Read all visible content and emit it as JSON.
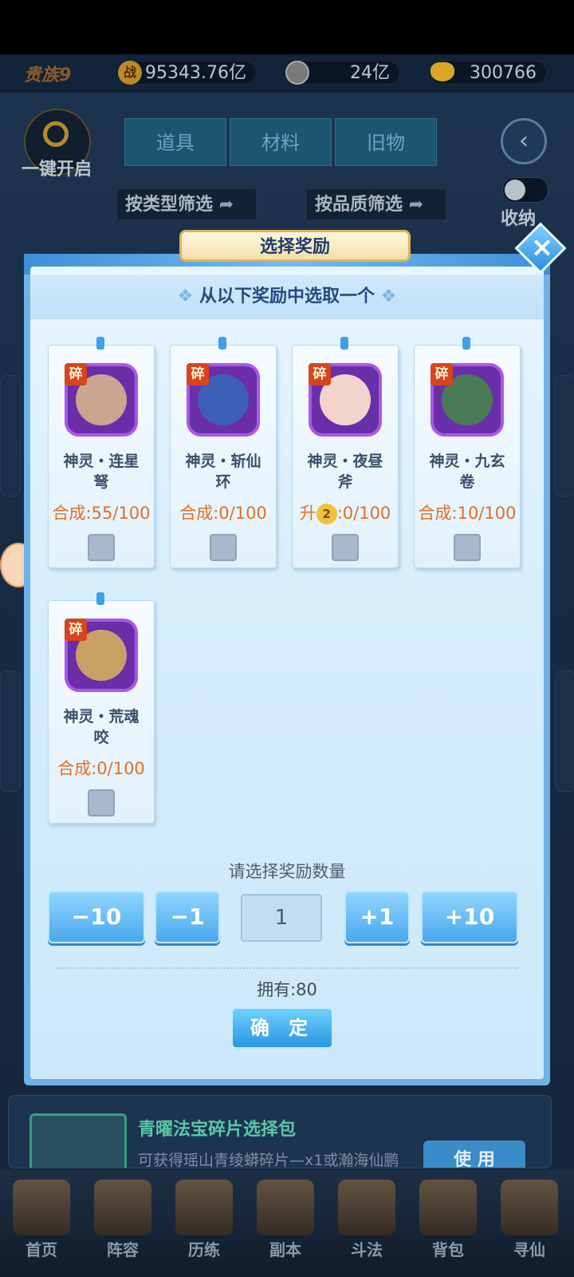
{
  "header": {
    "rank": "贵族9",
    "power_icon": "战",
    "power": "95343.76亿",
    "coin": "24亿",
    "ingot": "300766"
  },
  "left_controls": {
    "one_key_open": "一键开启"
  },
  "tabs": [
    {
      "label": "道具"
    },
    {
      "label": "材料"
    },
    {
      "label": "旧物"
    }
  ],
  "filters": {
    "by_type": "按类型筛选",
    "by_quality": "按品质筛选"
  },
  "collapse_label": "收纳",
  "dialog": {
    "title": "选择奖励",
    "subtitle": "从以下奖励中选取一个",
    "rewards": [
      {
        "badge": "碎",
        "name_line1": "神灵・连星",
        "name_line2": "弩",
        "progress": "合成:55/100",
        "face": "#caa58f"
      },
      {
        "badge": "碎",
        "name_line1": "神灵・斩仙",
        "name_line2": "环",
        "progress": "合成:0/100",
        "face": "#3d5fb8"
      },
      {
        "badge": "碎",
        "name_line1": "神灵・夜昼",
        "name_line2": "斧",
        "progress_prefix": "升",
        "star": "2",
        "progress_suffix": ":0/100",
        "face": "#f2d4cc"
      },
      {
        "badge": "碎",
        "name_line1": "神灵・九玄",
        "name_line2": "卷",
        "progress": "合成:10/100",
        "face": "#4a7a58"
      },
      {
        "badge": "碎",
        "name_line1": "神灵・荒魂",
        "name_line2": "咬",
        "progress": "合成:0/100",
        "face": "#c9a064"
      }
    ],
    "qty_prompt": "请选择奖励数量",
    "qty_buttons": {
      "minus10": "−10",
      "minus1": "−1",
      "plus1": "+1",
      "plus10": "+10"
    },
    "qty_value": "1",
    "owned": "拥有:80",
    "confirm": "确 定"
  },
  "pack": {
    "title": "青曜法宝碎片选择包",
    "desc": "可获得瑶山青绫蟒碎片—x1或瀚海仙鹏",
    "use_btn": "使 用"
  },
  "nav": [
    {
      "label": "首页"
    },
    {
      "label": "阵容"
    },
    {
      "label": "历练"
    },
    {
      "label": "副本"
    },
    {
      "label": "斗法"
    },
    {
      "label": "背包"
    },
    {
      "label": "寻仙"
    }
  ]
}
